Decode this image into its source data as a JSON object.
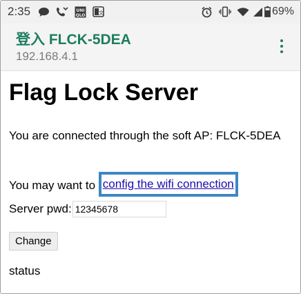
{
  "statusbar": {
    "time": "2:35",
    "battery_percent": "69%",
    "icons": [
      "chat-bubble-icon",
      "missed-call-icon",
      "uniqlo-app-icon",
      "translate-icon",
      "alarm-icon",
      "vibrate-icon",
      "wifi-icon",
      "signal-icon",
      "signal-icon-2",
      "battery-icon"
    ]
  },
  "appbar": {
    "title": "登入 FLCK-5DEA",
    "subtitle": "192.168.4.1",
    "accent_color": "#1e7d5f",
    "menu_icon": "more-vert-icon"
  },
  "page": {
    "heading": "Flag Lock Server",
    "connected_text": "You are connected through the soft AP: FLCK-5DEA",
    "wifi_prefix": "You may want to ",
    "wifi_link": "config the wifi connection",
    "pwd_label": "Server pwd:",
    "pwd_value": "12345678",
    "change_button": "Change",
    "status_text": "status",
    "highlight_color": "#3d86c6",
    "link_color": "#1a0dab"
  }
}
